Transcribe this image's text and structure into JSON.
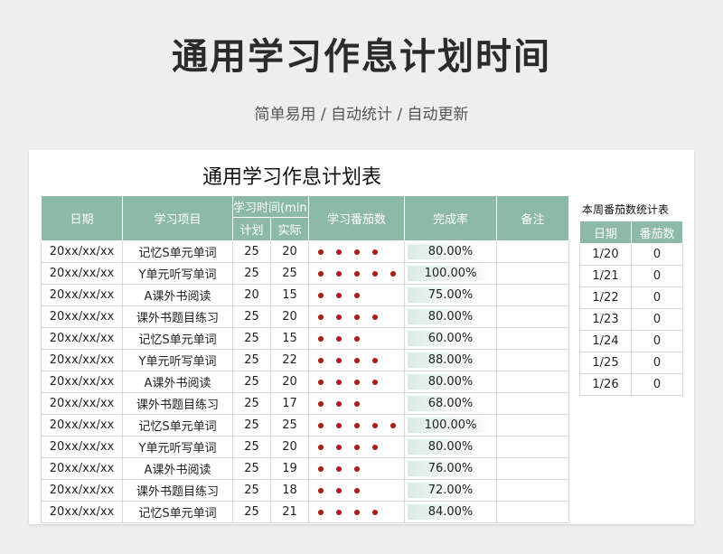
{
  "header": {
    "title": "通用学习作息计划时间",
    "subtitle": "简单易用 / 自动统计 / 自动更新"
  },
  "sheet": {
    "title": "通用学习作息计划表",
    "columns": {
      "date": "日期",
      "item": "学习项目",
      "time": "学习时间(min)",
      "plan": "计划",
      "actual": "实际",
      "tomato": "学习番茄数",
      "rate": "完成率",
      "note": "备注"
    },
    "rows": [
      {
        "date": "20xx/xx/xx",
        "item": "记忆S单元单词",
        "plan": "25",
        "actual": "20",
        "tomatoes": 4,
        "rate": "80.00%",
        "rate_value": 0.8,
        "note": ""
      },
      {
        "date": "20xx/xx/xx",
        "item": "Y单元听写单词",
        "plan": "25",
        "actual": "25",
        "tomatoes": 5,
        "rate": "100.00%",
        "rate_value": 1.0,
        "note": ""
      },
      {
        "date": "20xx/xx/xx",
        "item": "A课外书阅读",
        "plan": "20",
        "actual": "15",
        "tomatoes": 3,
        "rate": "75.00%",
        "rate_value": 0.75,
        "note": ""
      },
      {
        "date": "20xx/xx/xx",
        "item": "课外书题目练习",
        "plan": "25",
        "actual": "20",
        "tomatoes": 4,
        "rate": "80.00%",
        "rate_value": 0.8,
        "note": ""
      },
      {
        "date": "20xx/xx/xx",
        "item": "记忆S单元单词",
        "plan": "25",
        "actual": "15",
        "tomatoes": 3,
        "rate": "60.00%",
        "rate_value": 0.6,
        "note": ""
      },
      {
        "date": "20xx/xx/xx",
        "item": "Y单元听写单词",
        "plan": "25",
        "actual": "22",
        "tomatoes": 4,
        "rate": "88.00%",
        "rate_value": 0.88,
        "note": ""
      },
      {
        "date": "20xx/xx/xx",
        "item": "A课外书阅读",
        "plan": "25",
        "actual": "20",
        "tomatoes": 4,
        "rate": "80.00%",
        "rate_value": 0.8,
        "note": ""
      },
      {
        "date": "20xx/xx/xx",
        "item": "课外书题目练习",
        "plan": "25",
        "actual": "17",
        "tomatoes": 3,
        "rate": "68.00%",
        "rate_value": 0.68,
        "note": ""
      },
      {
        "date": "20xx/xx/xx",
        "item": "记忆S单元单词",
        "plan": "25",
        "actual": "25",
        "tomatoes": 5,
        "rate": "100.00%",
        "rate_value": 1.0,
        "note": ""
      },
      {
        "date": "20xx/xx/xx",
        "item": "Y单元听写单词",
        "plan": "25",
        "actual": "20",
        "tomatoes": 4,
        "rate": "80.00%",
        "rate_value": 0.8,
        "note": ""
      },
      {
        "date": "20xx/xx/xx",
        "item": "A课外书阅读",
        "plan": "25",
        "actual": "19",
        "tomatoes": 3,
        "rate": "76.00%",
        "rate_value": 0.76,
        "note": ""
      },
      {
        "date": "20xx/xx/xx",
        "item": "课外书题目练习",
        "plan": "25",
        "actual": "18",
        "tomatoes": 3,
        "rate": "72.00%",
        "rate_value": 0.72,
        "note": ""
      },
      {
        "date": "20xx/xx/xx",
        "item": "记忆S单元单词",
        "plan": "25",
        "actual": "21",
        "tomatoes": 4,
        "rate": "84.00%",
        "rate_value": 0.84,
        "note": ""
      }
    ],
    "colors": {
      "header_bg": "#8db9a7",
      "dot": "#b01818",
      "bar": "#dcebe5"
    }
  },
  "weekly": {
    "caption": "本周番茄数统计表",
    "columns": {
      "date": "日期",
      "count": "番茄数"
    },
    "rows": [
      {
        "date": "1/20",
        "count": "0"
      },
      {
        "date": "1/21",
        "count": "0"
      },
      {
        "date": "1/22",
        "count": "0"
      },
      {
        "date": "1/23",
        "count": "0"
      },
      {
        "date": "1/24",
        "count": "0"
      },
      {
        "date": "1/25",
        "count": "0"
      },
      {
        "date": "1/26",
        "count": "0"
      }
    ]
  }
}
